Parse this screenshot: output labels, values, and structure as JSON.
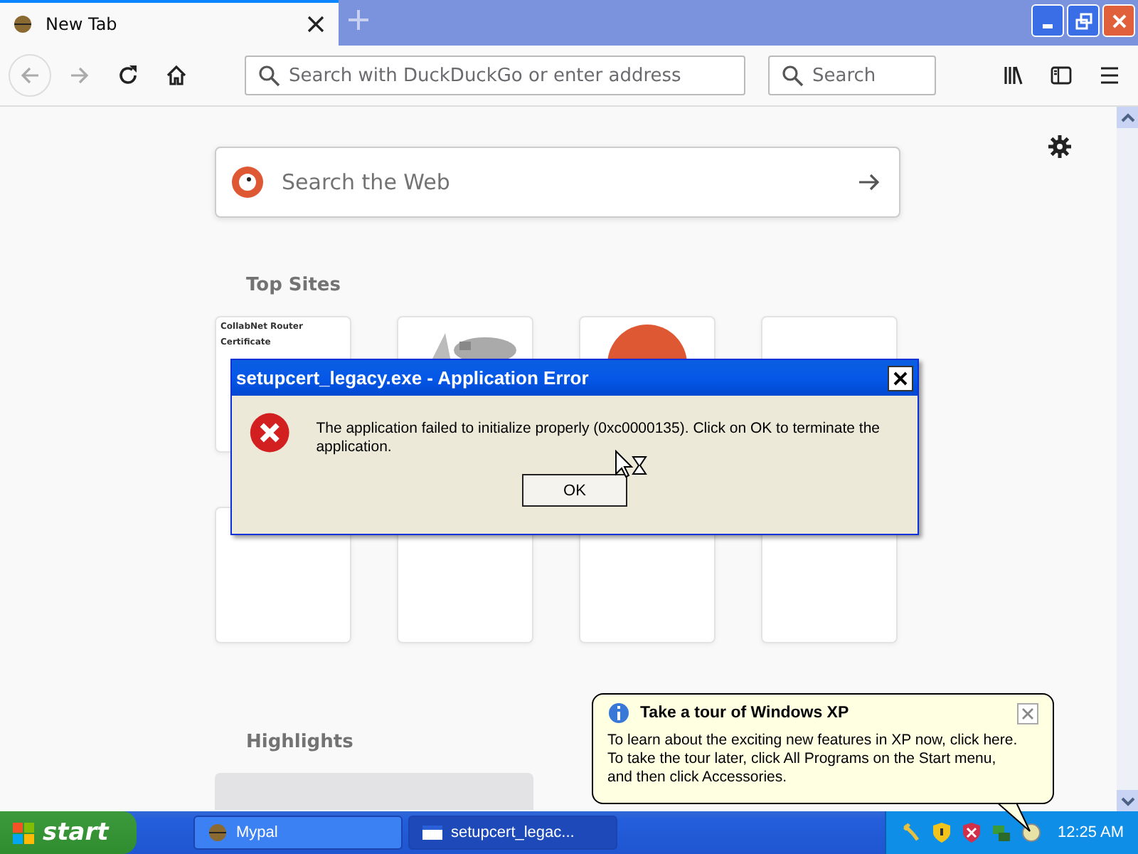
{
  "browser": {
    "tabs": [
      {
        "title": "New Tab",
        "selected": true
      }
    ],
    "address_placeholder": "Search with DuckDuckGo or enter address",
    "search_placeholder": "Search"
  },
  "page": {
    "search_placeholder": "Search the Web",
    "top_sites_heading": "Top Sites",
    "tiles": [
      {
        "kind": "document",
        "lines": [
          "CollabNet Router",
          "Certificate"
        ]
      },
      {
        "kind": "picture"
      },
      {
        "kind": "logo"
      },
      {
        "kind": "empty"
      },
      {
        "kind": "empty"
      },
      {
        "kind": "empty"
      },
      {
        "kind": "empty"
      },
      {
        "kind": "empty"
      }
    ],
    "highlights_heading": "Highlights"
  },
  "dialog": {
    "title": "setupcert_legacy.exe - Application Error",
    "message": "The application failed to initialize properly (0xc0000135). Click on OK to terminate the application.",
    "button": "OK"
  },
  "balloon": {
    "title": "Take a tour of Windows XP",
    "text": "To learn about the exciting new features in XP now, click here. To take the tour later, click All Programs on the Start menu, and then click Accessories."
  },
  "taskbar": {
    "start": "start",
    "tasks": [
      {
        "label": "Mypal",
        "selected": false,
        "kind": "browser"
      },
      {
        "label": "setupcert_legac...",
        "selected": true,
        "kind": "window"
      }
    ],
    "clock": "12:25 AM"
  }
}
